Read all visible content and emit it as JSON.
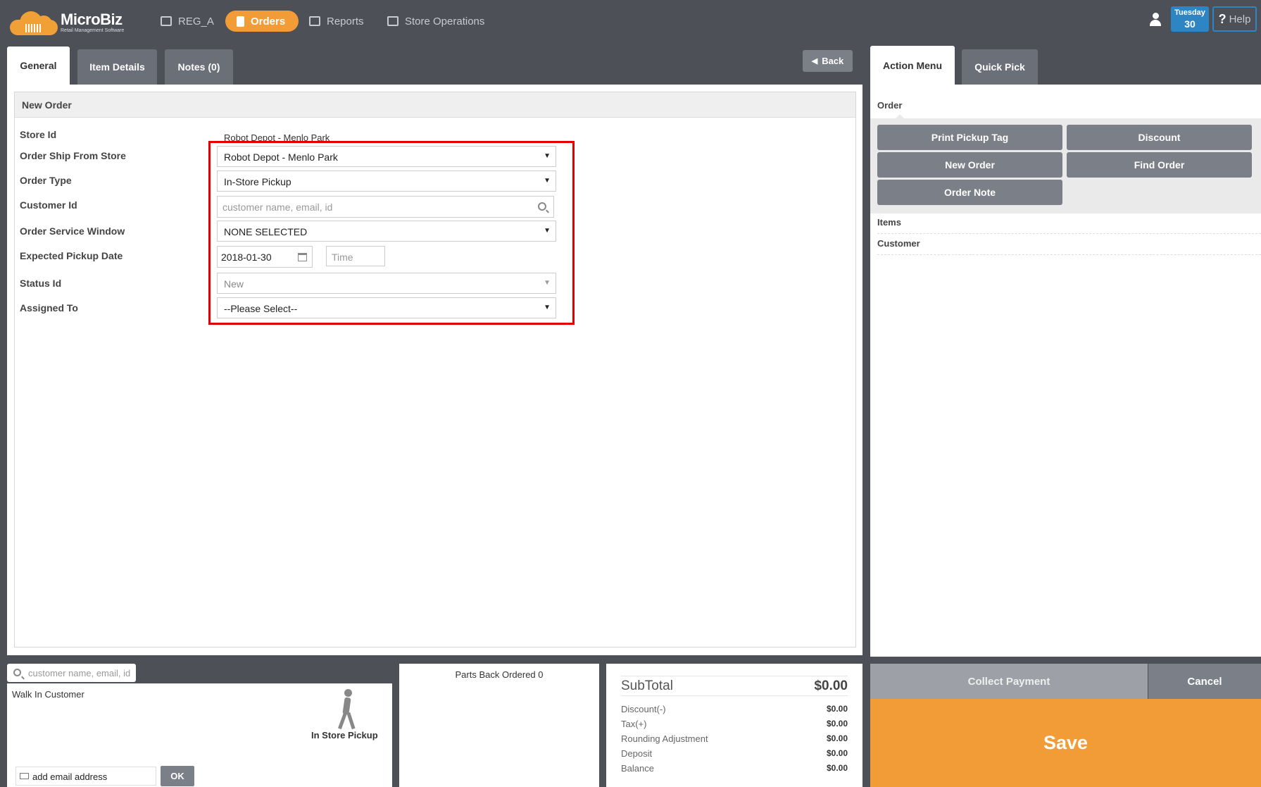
{
  "app": {
    "name": "MicroBiz",
    "tagline": "Retail Management Software"
  },
  "nav": {
    "items": [
      {
        "label": "REG_A",
        "icon": "register-icon"
      },
      {
        "label": "Orders",
        "icon": "clipboard-icon",
        "active": true
      },
      {
        "label": "Reports",
        "icon": "chart-icon"
      },
      {
        "label": "Store Operations",
        "icon": "store-icon"
      }
    ],
    "date": {
      "weekday": "Tuesday",
      "day": "30"
    },
    "help_label": "Help"
  },
  "tabs": [
    {
      "label": "General",
      "active": true
    },
    {
      "label": "Item Details"
    },
    {
      "label": "Notes (0)"
    }
  ],
  "back_label": "Back",
  "form": {
    "title": "New Order",
    "fields": {
      "store_id": {
        "label": "Store Id",
        "value": "Robot Depot - Menlo Park"
      },
      "ship_from": {
        "label": "Order Ship From Store",
        "value": "Robot Depot - Menlo Park"
      },
      "order_type": {
        "label": "Order Type",
        "value": "In-Store Pickup"
      },
      "customer_id": {
        "label": "Customer Id",
        "placeholder": "customer name, email, id"
      },
      "service_window": {
        "label": "Order Service Window",
        "value": "NONE SELECTED"
      },
      "pickup_date": {
        "label": "Expected Pickup Date",
        "value": "2018-01-30",
        "time_placeholder": "Time"
      },
      "status_id": {
        "label": "Status Id",
        "value": "New"
      },
      "assigned_to": {
        "label": "Assigned To",
        "value": "--Please Select--"
      }
    }
  },
  "right_panel": {
    "tabs": [
      {
        "label": "Action Menu",
        "active": true
      },
      {
        "label": "Quick Pick"
      }
    ],
    "section_label": "Order",
    "buttons": [
      "Print Pickup Tag",
      "Discount",
      "New Order",
      "Find Order",
      "Order Note"
    ],
    "sections": [
      "Items",
      "Customer"
    ]
  },
  "customer_panel": {
    "search_placeholder": "customer name, email, id",
    "customer_name": "Walk In Customer",
    "pickup_label": "In Store Pickup",
    "email_placeholder": "add email address",
    "ok_label": "OK"
  },
  "parts": {
    "label": "Parts Back Ordered 0"
  },
  "totals": {
    "subtotal": {
      "label": "SubTotal",
      "value": "$0.00"
    },
    "rows": [
      {
        "label": "Discount(-)",
        "value": "$0.00"
      },
      {
        "label": "Tax(+)",
        "value": "$0.00"
      },
      {
        "label": "Rounding Adjustment",
        "value": "$0.00"
      },
      {
        "label": "Deposit",
        "value": "$0.00"
      },
      {
        "label": "Balance",
        "value": "$0.00"
      }
    ]
  },
  "actions": {
    "collect": "Collect Payment",
    "cancel": "Cancel",
    "save": "Save"
  },
  "colors": {
    "accent": "#f29c38",
    "topbar": "#4d5057",
    "button": "#7b7f87",
    "highlight": "#e50000",
    "date": "#2d85c4"
  }
}
